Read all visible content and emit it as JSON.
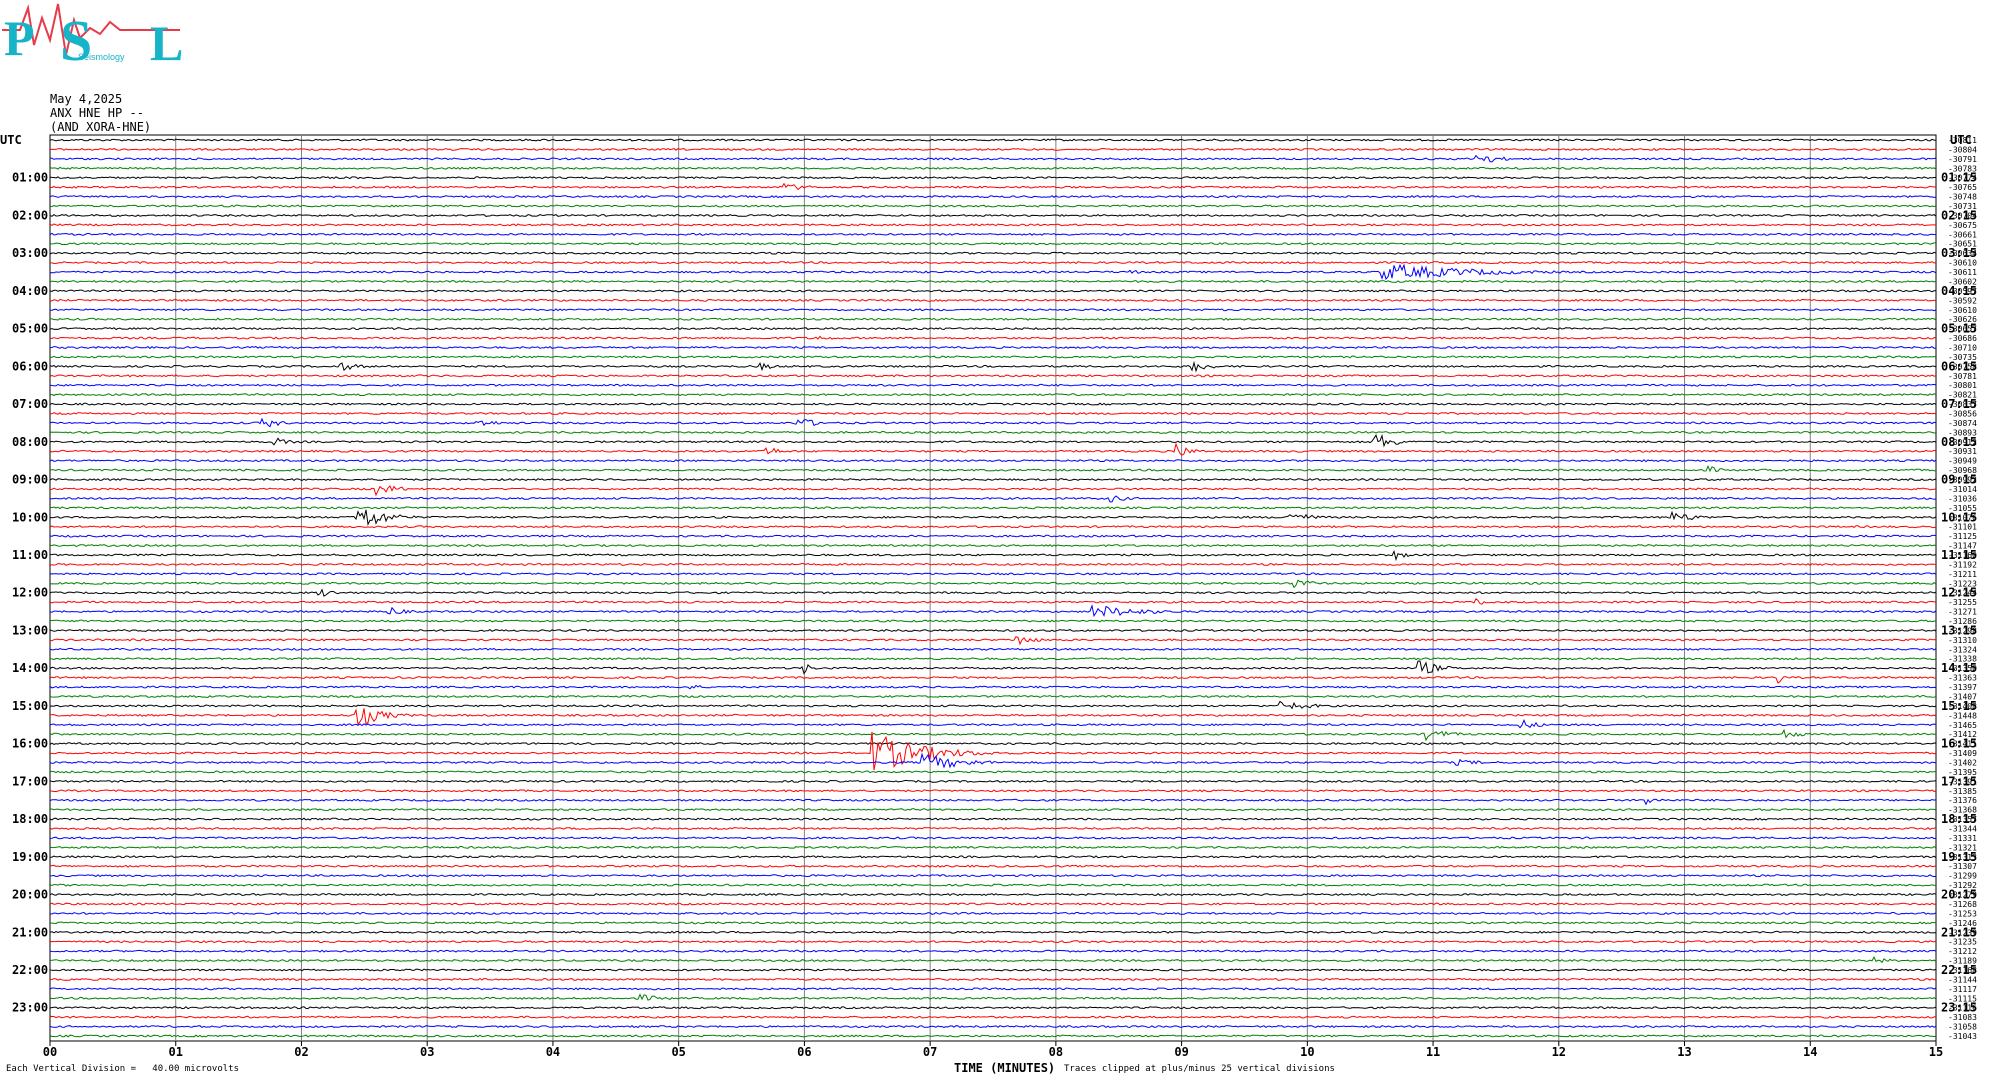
{
  "header": {
    "logo_text": "PSL",
    "logo_subtext": "Seismology",
    "date": "May 4,2025",
    "station": "ANX HNE HP --",
    "network": "(AND XORA-HNE)"
  },
  "footer": {
    "vertical_division": "Each Vertical Division =   40.00 microvolts",
    "xlabel": "TIME (MINUTES)",
    "clip_note": "Traces clipped at plus/minus 25 vertical divisions"
  },
  "colors": {
    "trace_cycle": [
      "#000000",
      "#ff0000",
      "#0000ff",
      "#008000"
    ],
    "grid": "#808080"
  },
  "chart_data": {
    "type": "line",
    "subtype": "helicorder",
    "xlabel": "TIME (MINUTES)",
    "x_range": [
      0,
      15
    ],
    "x_ticks": [
      "00",
      "01",
      "02",
      "03",
      "04",
      "05",
      "06",
      "07",
      "08",
      "09",
      "10",
      "11",
      "12",
      "13",
      "14",
      "15"
    ],
    "left_axis_title": "UTC",
    "right_axis_title": "UTC",
    "left_hour_labels": [
      "01:00",
      "02:00",
      "03:00",
      "04:00",
      "05:00",
      "06:00",
      "07:00",
      "08:00",
      "09:00",
      "10:00",
      "11:00",
      "12:00",
      "13:00",
      "14:00",
      "15:00",
      "16:00",
      "17:00",
      "18:00",
      "19:00",
      "20:00",
      "21:00",
      "22:00",
      "23:00"
    ],
    "right_hour_labels": [
      "01:15",
      "02:15",
      "03:15",
      "04:15",
      "05:15",
      "06:15",
      "07:15",
      "08:15",
      "09:15",
      "10:15",
      "11:15",
      "12:15",
      "13:15",
      "14:15",
      "15:15",
      "16:15",
      "17:15",
      "18:15",
      "19:15",
      "20:15",
      "21:15",
      "22:15",
      "23:15"
    ],
    "row_minutes": 15,
    "rows_count": 96,
    "row_offsets": [
      "-30811",
      "-30804",
      "-30791",
      "-30783",
      "-30774",
      "-30765",
      "-30748",
      "-30731",
      "-30704",
      "-30675",
      "-30661",
      "-30651",
      "-30634",
      "-30610",
      "-30611",
      "-30602",
      "-30597",
      "-30592",
      "-30610",
      "-30626",
      "-30657",
      "-30686",
      "-30710",
      "-30735",
      "-30758",
      "-30781",
      "-30801",
      "-30821",
      "-30837",
      "-30856",
      "-30874",
      "-30893",
      "-30912",
      "-30931",
      "-30949",
      "-30968",
      "-30992",
      "-31014",
      "-31036",
      "-31055",
      "-31076",
      "-31101",
      "-31125",
      "-31147",
      "-31160",
      "-31192",
      "-31211",
      "-31223",
      "-31244",
      "-31255",
      "-31271",
      "-31286",
      "-31298",
      "-31310",
      "-31324",
      "-31338",
      "-31350",
      "-31363",
      "-31397",
      "-31407",
      "-31408",
      "-31448",
      "-31465",
      "-31412",
      "-31411",
      "-31409",
      "-31402",
      "-31395",
      "-31391",
      "-31385",
      "-31376",
      "-31368",
      "-31357",
      "-31344",
      "-31331",
      "-31321",
      "-31313",
      "-31307",
      "-31299",
      "-31292",
      "-31279",
      "-31268",
      "-31253",
      "-31246",
      "-31239",
      "-31235",
      "-31212",
      "-31189",
      "-31168",
      "-31144",
      "-31117",
      "-31115",
      "-31116",
      "-31083",
      "-31058",
      "-31043"
    ],
    "events": [
      {
        "row": 2,
        "minute": 11.35,
        "amp": 7,
        "dur": 0.25
      },
      {
        "row": 5,
        "minute": 5.85,
        "amp": 4,
        "dur": 0.3
      },
      {
        "row": 14,
        "minute": 10.6,
        "amp": 9,
        "dur": 1.1
      },
      {
        "row": 14,
        "minute": 8.6,
        "amp": 3,
        "dur": 0.1
      },
      {
        "row": 21,
        "minute": 6.1,
        "amp": 3,
        "dur": 0.2
      },
      {
        "row": 24,
        "minute": 2.3,
        "amp": 5,
        "dur": 0.25
      },
      {
        "row": 24,
        "minute": 9.1,
        "amp": 6,
        "dur": 0.2
      },
      {
        "row": 24,
        "minute": 5.65,
        "amp": 4,
        "dur": 0.2
      },
      {
        "row": 30,
        "minute": 1.7,
        "amp": 6,
        "dur": 0.2
      },
      {
        "row": 30,
        "minute": 5.95,
        "amp": 7,
        "dur": 0.2
      },
      {
        "row": 30,
        "minute": 3.4,
        "amp": 4,
        "dur": 0.3
      },
      {
        "row": 32,
        "minute": 10.55,
        "amp": 9,
        "dur": 0.25
      },
      {
        "row": 32,
        "minute": 1.8,
        "amp": 4,
        "dur": 0.2
      },
      {
        "row": 33,
        "minute": 5.7,
        "amp": 6,
        "dur": 0.15
      },
      {
        "row": 33,
        "minute": 8.95,
        "amp": 8,
        "dur": 0.2
      },
      {
        "row": 35,
        "minute": 13.2,
        "amp": 4,
        "dur": 0.15
      },
      {
        "row": 37,
        "minute": 2.6,
        "amp": 6,
        "dur": 0.3
      },
      {
        "row": 38,
        "minute": 8.45,
        "amp": 4,
        "dur": 0.2
      },
      {
        "row": 40,
        "minute": 2.45,
        "amp": 16,
        "dur": 0.3
      },
      {
        "row": 40,
        "minute": 9.85,
        "amp": 6,
        "dur": 0.3
      },
      {
        "row": 40,
        "minute": 12.9,
        "amp": 6,
        "dur": 0.3
      },
      {
        "row": 44,
        "minute": 10.7,
        "amp": 5,
        "dur": 0.15
      },
      {
        "row": 47,
        "minute": 9.9,
        "amp": 5,
        "dur": 0.25
      },
      {
        "row": 48,
        "minute": 2.15,
        "amp": 6,
        "dur": 0.15
      },
      {
        "row": 49,
        "minute": 11.35,
        "amp": 8,
        "dur": 0.05
      },
      {
        "row": 50,
        "minute": 2.7,
        "amp": 5,
        "dur": 0.2
      },
      {
        "row": 50,
        "minute": 8.3,
        "amp": 7,
        "dur": 0.6
      },
      {
        "row": 53,
        "minute": 7.7,
        "amp": 6,
        "dur": 0.2
      },
      {
        "row": 56,
        "minute": 6.0,
        "amp": 6,
        "dur": 0.1
      },
      {
        "row": 56,
        "minute": 10.9,
        "amp": 8,
        "dur": 0.25
      },
      {
        "row": 57,
        "minute": 13.75,
        "amp": 7,
        "dur": 0.05
      },
      {
        "row": 58,
        "minute": 5.05,
        "amp": 4,
        "dur": 0.2
      },
      {
        "row": 60,
        "minute": 9.8,
        "amp": 5,
        "dur": 0.4
      },
      {
        "row": 61,
        "minute": 2.45,
        "amp": 12,
        "dur": 0.3
      },
      {
        "row": 62,
        "minute": 11.7,
        "amp": 6,
        "dur": 0.2
      },
      {
        "row": 63,
        "minute": 10.95,
        "amp": 6,
        "dur": 0.3
      },
      {
        "row": 63,
        "minute": 13.8,
        "amp": 5,
        "dur": 0.2
      },
      {
        "row": 65,
        "minute": 6.55,
        "amp": 22,
        "dur": 0.6
      },
      {
        "row": 66,
        "minute": 6.95,
        "amp": 9,
        "dur": 0.5
      },
      {
        "row": 66,
        "minute": 11.2,
        "amp": 3,
        "dur": 0.4
      },
      {
        "row": 70,
        "minute": 12.7,
        "amp": 5,
        "dur": 0.15
      },
      {
        "row": 91,
        "minute": 4.7,
        "amp": 4,
        "dur": 0.3
      },
      {
        "row": 87,
        "minute": 14.5,
        "amp": 4,
        "dur": 0.2
      }
    ]
  }
}
